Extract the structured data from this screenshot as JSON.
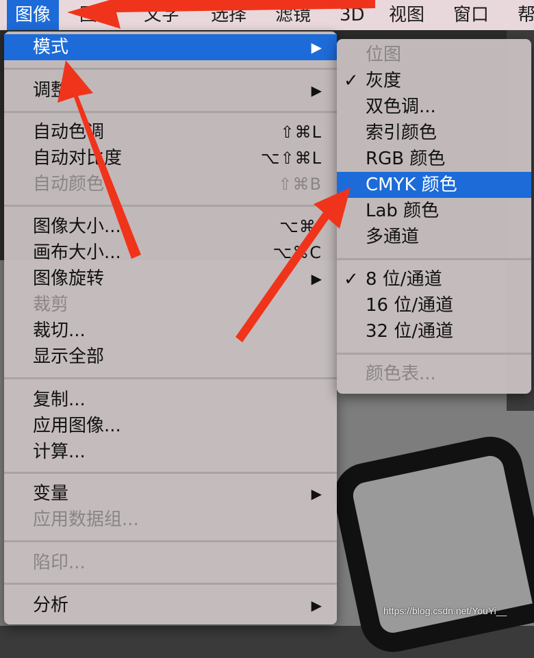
{
  "menubar": {
    "items": [
      {
        "label": "图像",
        "active": true
      },
      {
        "label": "图层"
      },
      {
        "label": "文字"
      },
      {
        "label": "选择"
      },
      {
        "label": "滤镜"
      },
      {
        "label": "3D"
      },
      {
        "label": "视图"
      },
      {
        "label": "窗口"
      },
      {
        "label": "帮"
      }
    ]
  },
  "main_menu": {
    "items": [
      {
        "label": "模式",
        "submenu": true,
        "highlighted": true
      },
      {
        "label": "调整",
        "submenu": true
      },
      {
        "label": "自动色调",
        "shortcut": "⇧⌘L"
      },
      {
        "label": "自动对比度",
        "shortcut": "⌥⇧⌘L"
      },
      {
        "label": "自动颜色",
        "shortcut": "⇧⌘B",
        "disabled": true
      },
      {
        "label": "图像大小...",
        "shortcut": "⌥⌘I"
      },
      {
        "label": "画布大小...",
        "shortcut": "⌥⌘C"
      },
      {
        "label": "图像旋转",
        "submenu": true
      },
      {
        "label": "裁剪",
        "disabled": true
      },
      {
        "label": "裁切..."
      },
      {
        "label": "显示全部"
      },
      {
        "label": "复制..."
      },
      {
        "label": "应用图像..."
      },
      {
        "label": "计算..."
      },
      {
        "label": "变量",
        "submenu": true
      },
      {
        "label": "应用数据组...",
        "disabled": true
      },
      {
        "label": "陷印...",
        "disabled": true
      },
      {
        "label": "分析",
        "submenu": true
      }
    ]
  },
  "mode_submenu": {
    "items": [
      {
        "label": "位图",
        "disabled": true
      },
      {
        "label": "灰度",
        "checked": true
      },
      {
        "label": "双色调..."
      },
      {
        "label": "索引颜色"
      },
      {
        "label": "RGB 颜色"
      },
      {
        "label": "CMYK 颜色",
        "highlighted": true
      },
      {
        "label": "Lab 颜色"
      },
      {
        "label": "多通道"
      },
      {
        "label": "8 位/通道",
        "checked": true
      },
      {
        "label": "16 位/通道"
      },
      {
        "label": "32 位/通道"
      },
      {
        "label": "颜色表...",
        "disabled": true
      }
    ]
  },
  "glyphs": {
    "submenu_arrow": "▶",
    "checkmark": "✓"
  },
  "watermark": "https://blog.csdn.net/YouYi__",
  "colors": {
    "highlight": "#1d6bd8",
    "arrow_red": "#f0341c"
  }
}
